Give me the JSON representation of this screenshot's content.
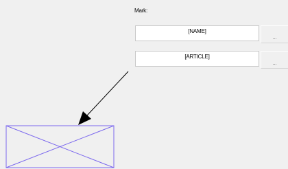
{
  "mark_label": "Mark:",
  "fields": [
    {
      "value": "[NAME]",
      "browse_label": "..."
    },
    {
      "value": "[ARTICLE]",
      "browse_label": "..."
    }
  ],
  "colors": {
    "background": "#f0f0f0",
    "placeholder_frame": "#7b68ee",
    "arrow": "#000000"
  },
  "icons": {
    "placeholder": "crossed-rectangle-placeholder",
    "arrow": "leader-arrow"
  }
}
